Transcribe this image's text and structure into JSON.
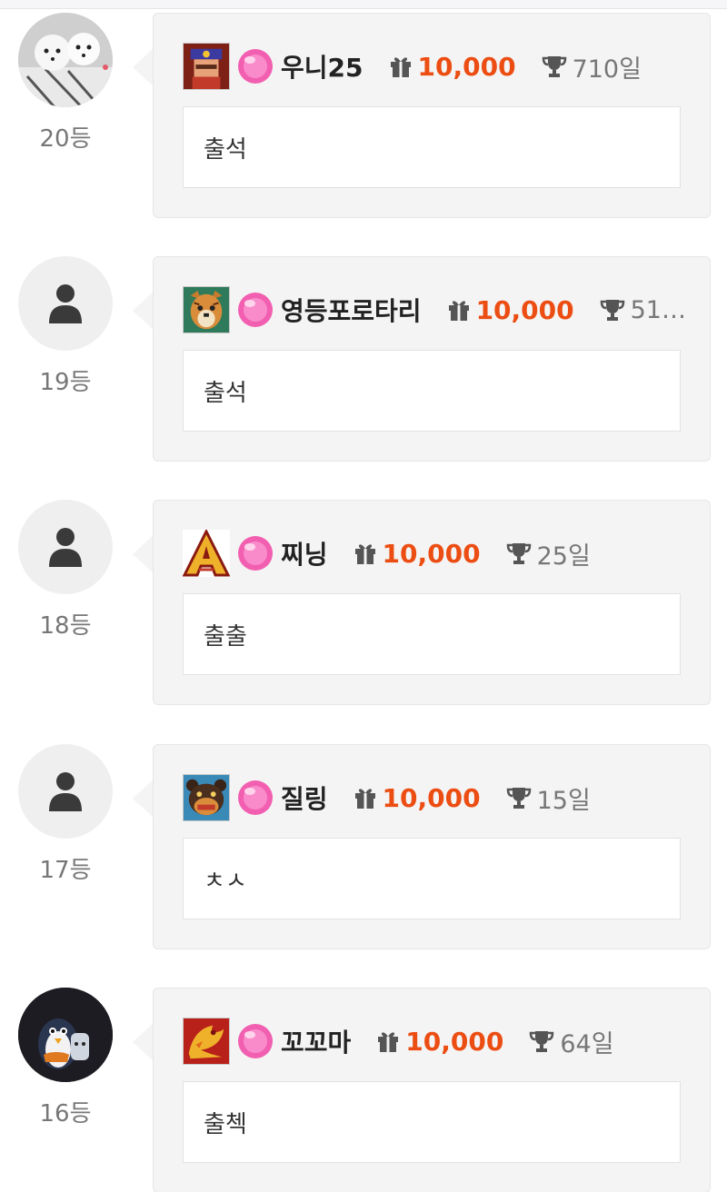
{
  "entries": [
    {
      "rank": "20등",
      "nickname": "우니25",
      "points": "10,000",
      "days": "710일",
      "comment": "출석",
      "avatar": "photo-dogs",
      "badge": "soldier-badge"
    },
    {
      "rank": "19등",
      "nickname": "영등포로타리",
      "points": "10,000",
      "days": "51…",
      "comment": "출석",
      "avatar": "default-user",
      "badge": "tiger-badge"
    },
    {
      "rank": "18등",
      "nickname": "찌닝",
      "points": "10,000",
      "days": "25일",
      "comment": "출출",
      "avatar": "default-user",
      "badge": "letter-a-badge"
    },
    {
      "rank": "17등",
      "nickname": "질링",
      "points": "10,000",
      "days": "15일",
      "comment": "ㅊㅅ",
      "avatar": "default-user",
      "badge": "bear-badge"
    },
    {
      "rank": "16등",
      "nickname": "꼬꼬마",
      "points": "10,000",
      "days": "64일",
      "comment": "출첵",
      "avatar": "photo-penguin",
      "badge": "dragon-badge"
    }
  ],
  "colors": {
    "points": "#ec4d12",
    "card_bg": "#f4f4f4",
    "gem": "#f25fb0"
  }
}
